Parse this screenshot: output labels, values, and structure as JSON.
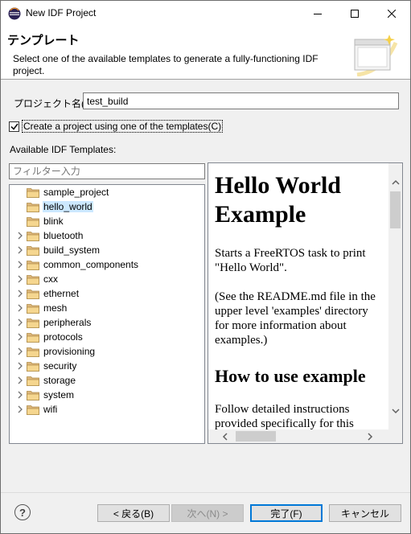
{
  "window": {
    "title": "New IDF Project"
  },
  "header": {
    "title": "テンプレート",
    "description": "Select one of the available templates to generate a fully-functioning IDF project."
  },
  "project": {
    "label": "プロジェクト名(P):",
    "value": "test_build"
  },
  "use_template": {
    "label": "Create a project using one of the templates(C)",
    "checked": true
  },
  "templates": {
    "label": "Available IDF Templates:",
    "filter_placeholder": "フィルター入力",
    "items": [
      {
        "label": "sample_project",
        "expandable": false,
        "selected": false
      },
      {
        "label": "hello_world",
        "expandable": false,
        "selected": true
      },
      {
        "label": "blink",
        "expandable": false,
        "selected": false
      },
      {
        "label": "bluetooth",
        "expandable": true,
        "selected": false
      },
      {
        "label": "build_system",
        "expandable": true,
        "selected": false
      },
      {
        "label": "common_components",
        "expandable": true,
        "selected": false
      },
      {
        "label": "cxx",
        "expandable": true,
        "selected": false
      },
      {
        "label": "ethernet",
        "expandable": true,
        "selected": false
      },
      {
        "label": "mesh",
        "expandable": true,
        "selected": false
      },
      {
        "label": "peripherals",
        "expandable": true,
        "selected": false
      },
      {
        "label": "protocols",
        "expandable": true,
        "selected": false
      },
      {
        "label": "provisioning",
        "expandable": true,
        "selected": false
      },
      {
        "label": "security",
        "expandable": true,
        "selected": false
      },
      {
        "label": "storage",
        "expandable": true,
        "selected": false
      },
      {
        "label": "system",
        "expandable": true,
        "selected": false
      },
      {
        "label": "wifi",
        "expandable": true,
        "selected": false
      }
    ]
  },
  "preview": {
    "heading": "Hello World Example",
    "para1": "Starts a FreeRTOS task to print \"Hello World\".",
    "para2": "(See the README.md file in the upper level 'examples' directory for more information about examples.)",
    "heading2": "How to use example",
    "para3": "Follow detailed instructions provided specifically for this"
  },
  "buttons": {
    "back": "< 戻る(B)",
    "next": "次へ(N) >",
    "finish": "完了(F)",
    "cancel": "キャンセル"
  },
  "colors": {
    "selection": "#cce8ff",
    "default_button_border": "#0078d7",
    "folder": "#dcb67a"
  }
}
